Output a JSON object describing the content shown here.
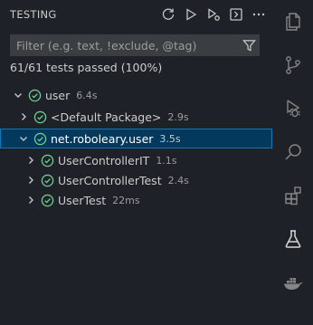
{
  "panel": {
    "title": "TESTING",
    "toolbar_icons": [
      "refresh-icon",
      "run-all-icon",
      "debug-all-icon",
      "go-to-test-icon",
      "more-icon"
    ]
  },
  "filter": {
    "placeholder": "Filter (e.g. text, !exclude, @tag)",
    "value": ""
  },
  "summary": "61/61 tests passed (100%)",
  "tree": {
    "root": {
      "label": "user",
      "duration": "6.4s",
      "expanded": true
    },
    "default_package": {
      "label": "<Default Package>",
      "duration": "2.9s",
      "expanded": false
    },
    "package": {
      "label": "net.roboleary.user",
      "duration": "3.5s",
      "expanded": true,
      "selected": true
    },
    "classes": [
      {
        "label": "UserControllerIT",
        "duration": "1.1s"
      },
      {
        "label": "UserControllerTest",
        "duration": "2.4s"
      },
      {
        "label": "UserTest",
        "duration": "22ms"
      }
    ]
  },
  "activity_bar": [
    "explorer-icon",
    "source-control-icon",
    "run-debug-icon",
    "search-icon",
    "extensions-icon",
    "testing-icon",
    "docker-icon"
  ],
  "colors": {
    "background": "#1f2128",
    "pass": "#73c991",
    "selection": "#04395e",
    "focus_border": "#0e76ba"
  }
}
